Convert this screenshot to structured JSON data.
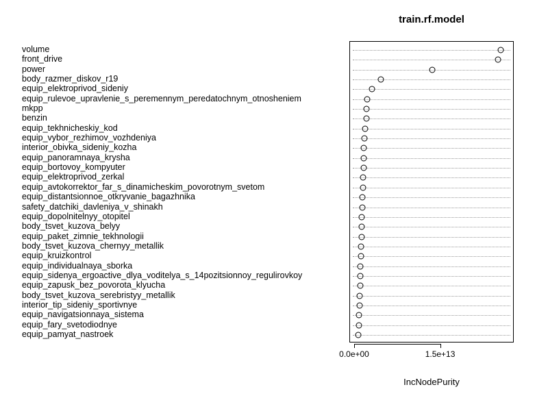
{
  "chart_data": {
    "type": "dotplot",
    "title": "train.rf.model",
    "xlabel": "IncNodePurity",
    "ylabel": "",
    "xlim": [
      0,
      27000000000000.0
    ],
    "xticks": [
      {
        "value": 0,
        "label": "0.0e+00"
      },
      {
        "value": 15000000000000.0,
        "label": "1.5e+13"
      }
    ],
    "categories": [
      "volume",
      "front_drive",
      "power",
      "body_razmer_diskov_r19",
      "equip_elektroprivod_sideniy",
      "equip_rulevoe_upravlenie_s_peremennym_peredatochnym_otnosheniem",
      "mkpp",
      "benzin",
      "equip_tekhnicheskiy_kod",
      "equip_vybor_rezhimov_vozhdeniya",
      "interior_obivka_sideniy_kozha",
      "equip_panoramnaya_krysha",
      "equip_bortovoy_kompyuter",
      "equip_elektroprivod_zerkal",
      "equip_avtokorrektor_far_s_dinamicheskim_povorotnym_svetom",
      "equip_distantsionnoe_otkryvanie_bagazhnika",
      "safety_datchiki_davleniya_v_shinakh",
      "equip_dopolnitelnyy_otopitel",
      "body_tsvet_kuzova_belyy",
      "equip_paket_zimnie_tekhnologii",
      "body_tsvet_kuzova_chernyy_metallik",
      "equip_kruizkontrol",
      "equip_individualnaya_sborka",
      "equip_sidenya_ergoactive_dlya_voditelya_s_14pozitsionnoy_regulirovkoy",
      "equip_zapusk_bez_povorota_klyucha",
      "body_tsvet_kuzova_serebristyy_metallik",
      "interior_tip_sideniy_sportivnye",
      "equip_navigatsionnaya_sistema",
      "equip_fary_svetodiodnye",
      "equip_pamyat_nastroek"
    ],
    "values": [
      25500000000000.0,
      25000000000000.0,
      13500000000000.0,
      4500000000000.0,
      3000000000000.0,
      2200000000000.0,
      2000000000000.0,
      2000000000000.0,
      1800000000000.0,
      1700000000000.0,
      1600000000000.0,
      1550000000000.0,
      1500000000000.0,
      1450000000000.0,
      1400000000000.0,
      1350000000000.0,
      1300000000000.0,
      1250000000000.0,
      1200000000000.0,
      1150000000000.0,
      1100000000000.0,
      1050000000000.0,
      1000000000000.0,
      950000000000.0,
      900000000000.0,
      850000000000.0,
      800000000000.0,
      750000000000.0,
      700000000000.0,
      650000000000.0
    ]
  }
}
